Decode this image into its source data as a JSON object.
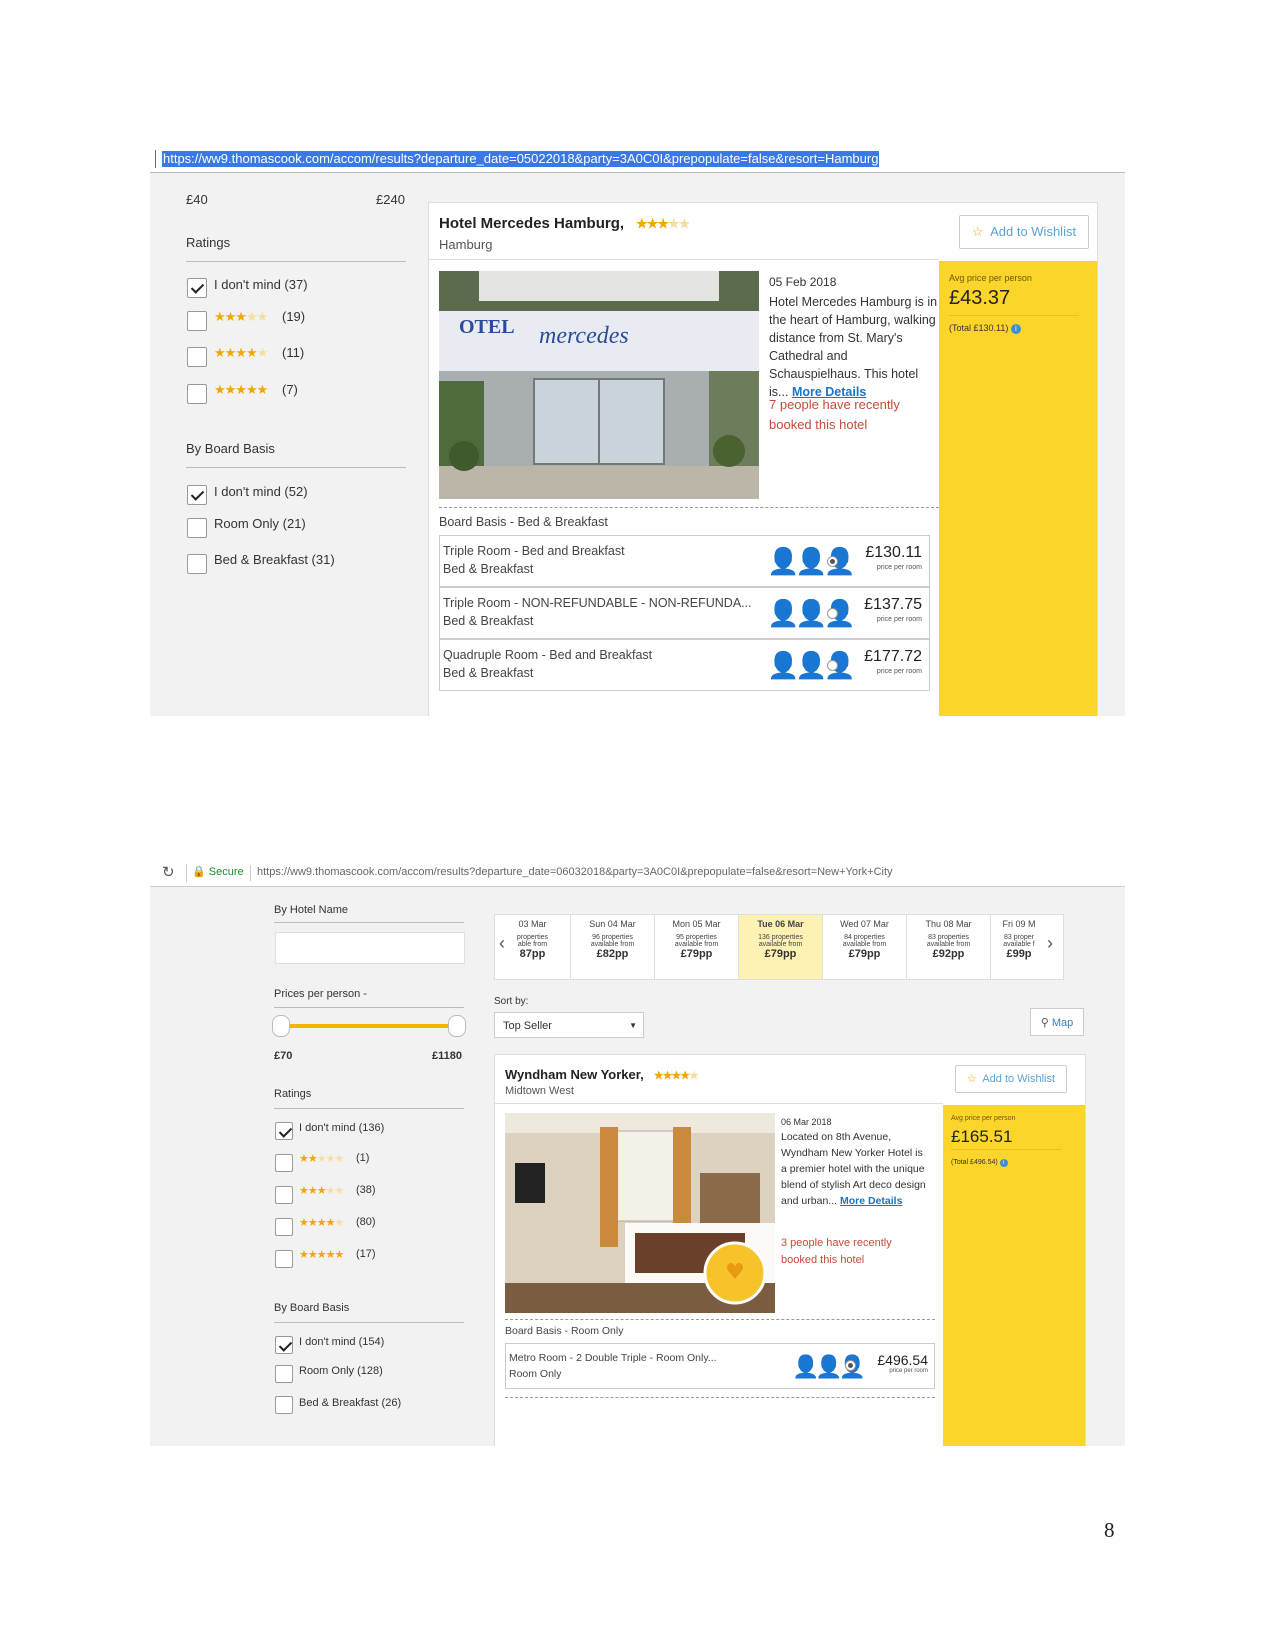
{
  "page_number": "8",
  "shot1": {
    "url": "https://ww9.thomascook.com/accom/results?departure_date=05022018&party=3A0C0I&prepopulate=false&resort=Hamburg",
    "price_min": "£40",
    "price_max": "£240",
    "ratings_title": "Ratings",
    "ratings": [
      {
        "label": "I don't mind (37)",
        "checked": true
      },
      {
        "count": "(19)",
        "stars": 3
      },
      {
        "count": "(11)",
        "stars": 4
      },
      {
        "count": "(7)",
        "stars": 5
      }
    ],
    "board_title": "By Board Basis",
    "board": [
      {
        "label": "I don't mind (52)",
        "checked": true
      },
      {
        "label": "Room Only (21)",
        "checked": false
      },
      {
        "label": "Bed & Breakfast (31)",
        "checked": false
      }
    ],
    "hotel": {
      "name": "Hotel Mercedes Hamburg,",
      "location": "Hamburg",
      "stars": 3,
      "wishlist": "Add to Wishlist",
      "date": "05 Feb 2018",
      "description": "Hotel Mercedes Hamburg is in the heart of Hamburg, walking distance from St. Mary's Cathedral and Schauspielhaus. This hotel is...",
      "more_details": "More Details",
      "booked": "7 people have recently booked this hotel",
      "avg_label": "Avg price per person",
      "avg_price": "£43.37",
      "total": "(Total £130.11)",
      "board_basis": "Board Basis -  Bed & Breakfast",
      "rooms": [
        {
          "name": "Triple Room - Bed and Breakfast",
          "board": "Bed & Breakfast",
          "price": "£130.11",
          "per": "price per room",
          "selected": true
        },
        {
          "name": "Triple Room - NON-REFUNDABLE - NON-REFUNDA...",
          "board": "Bed & Breakfast",
          "price": "£137.75",
          "per": "price per room",
          "selected": false
        },
        {
          "name": "Quadruple Room - Bed and Breakfast",
          "board": "Bed & Breakfast",
          "price": "£177.72",
          "per": "price per room",
          "selected": false
        }
      ]
    }
  },
  "shot2": {
    "secure": "Secure",
    "url": "https://ww9.thomascook.com/accom/results?departure_date=06032018&party=3A0C0I&prepopulate=false&resort=New+York+City",
    "hotel_name_title": "By Hotel Name",
    "prices_title": "Prices per person -",
    "price_min": "£70",
    "price_max": "£1180",
    "ratings_title": "Ratings",
    "ratings": [
      {
        "label": "I don't mind (136)",
        "checked": true
      },
      {
        "count": "(1)",
        "stars": 2
      },
      {
        "count": "(38)",
        "stars": 3
      },
      {
        "count": "(80)",
        "stars": 4
      },
      {
        "count": "(17)",
        "stars": 5
      }
    ],
    "board_title": "By Board Basis",
    "board": [
      {
        "label": "I don't mind (154)",
        "checked": true
      },
      {
        "label": "Room Only (128)",
        "checked": false
      },
      {
        "label": "Bed & Breakfast (26)",
        "checked": false
      }
    ],
    "dates": [
      {
        "day": "03 Mar",
        "props": "properties",
        "avail": "able from",
        "price": "87pp"
      },
      {
        "day": "Sun 04 Mar",
        "props": "96 properties",
        "avail": "available from",
        "price": "£82pp"
      },
      {
        "day": "Mon 05 Mar",
        "props": "95 properties",
        "avail": "available from",
        "price": "£79pp"
      },
      {
        "day": "Tue 06 Mar",
        "props": "136 properties",
        "avail": "available from",
        "price": "£79pp",
        "active": true
      },
      {
        "day": "Wed 07 Mar",
        "props": "84 properties",
        "avail": "available from",
        "price": "£79pp"
      },
      {
        "day": "Thu 08 Mar",
        "props": "83 properties",
        "avail": "available from",
        "price": "£92pp"
      },
      {
        "day": "Fri 09 M",
        "props": "83 proper",
        "avail": "available f",
        "price": "£99p"
      }
    ],
    "sort_label": "Sort by:",
    "sort_value": "Top Seller",
    "map": "Map",
    "hotel": {
      "name": "Wyndham New Yorker,",
      "location": "Midtown West",
      "stars": 4,
      "wishlist": "Add to Wishlist",
      "date": "06 Mar 2018",
      "description": "Located on 8th Avenue, Wyndham New Yorker Hotel is a premier hotel with the unique blend of stylish Art deco design and urban...",
      "more_details": "More Details",
      "booked": "3 people have recently booked this hotel",
      "avg_label": "Avg price per person",
      "avg_price": "£165.51",
      "total": "(Total £496.54)",
      "board_basis": "Board Basis -  Room Only",
      "badge": "RECOMMENDED",
      "rooms": [
        {
          "name": "Metro Room - 2 Double Triple - Room Only...",
          "board": "Room Only",
          "price": "£496.54",
          "per": "price per room",
          "selected": true
        }
      ]
    }
  }
}
